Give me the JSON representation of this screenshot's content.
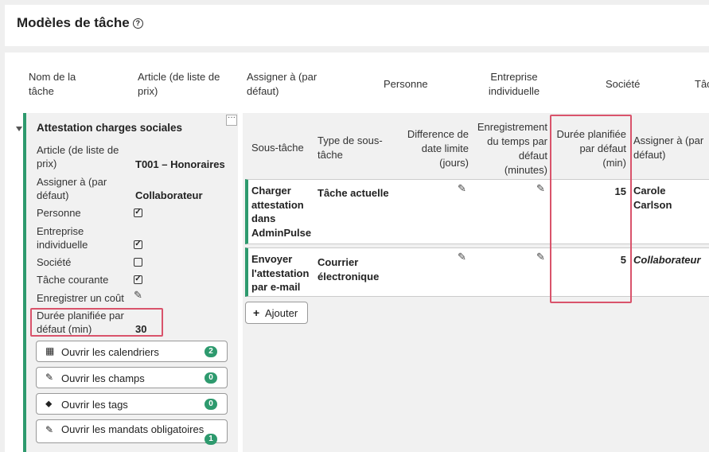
{
  "page": {
    "title": "Modèles de tâche",
    "help_icon": "?"
  },
  "columns": [
    "Nom de la tâche",
    "Article (de liste de prix)",
    "Assigner à (par défaut)",
    "Personne",
    "Entreprise individuelle",
    "Société",
    "Tâc"
  ],
  "template": {
    "title": "Attestation charges sociales",
    "menu_glyph": "···",
    "fields": {
      "article_label": "Article (de liste de prix)",
      "article_value": "T001 – Honoraires",
      "assign_label": "Assigner à (par défaut)",
      "assign_value": "Collaborateur",
      "personne_label": "Personne",
      "personne_checked": true,
      "entreprise_label": "Entreprise individuelle",
      "entreprise_checked": true,
      "societe_label": "Société",
      "societe_checked": false,
      "courante_label": "Tâche courante",
      "courante_checked": true,
      "cout_label": "Enregistrer un coût",
      "duree_label": "Durée planifiée par défaut (min)",
      "duree_value": "30"
    },
    "buttons": [
      {
        "label": "Ouvrir les calendriers",
        "badge": "2",
        "icon": "calendar-icon"
      },
      {
        "label": "Ouvrir les champs",
        "badge": "0",
        "icon": "edit-icon"
      },
      {
        "label": "Ouvrir les tags",
        "badge": "0",
        "icon": "tags-icon"
      },
      {
        "label": "Ouvrir les mandats obligatoires",
        "badge": "1",
        "icon": "edit-icon"
      }
    ]
  },
  "subtasks": {
    "headers": [
      "Sous-tâche",
      "Type de sous-tâche",
      "Difference de date limite (jours)",
      "Enregistrement du temps par défaut (minutes)",
      "Durée planifiée par défaut (min)",
      "Assigner à (par défaut)"
    ],
    "rows": [
      {
        "name": "Charger attestation dans AdminPulse",
        "type": "Tâche actuelle",
        "duration": "15",
        "assignee": "Carole Carlson"
      },
      {
        "name": "Envoyer l'attestation par e-mail",
        "type": "Courrier électronique",
        "duration": "5",
        "assignee": "Collaborateur"
      }
    ],
    "add_label": "Ajouter"
  },
  "colors": {
    "accent": "#2e9a6e",
    "highlight": "#d9536b"
  }
}
